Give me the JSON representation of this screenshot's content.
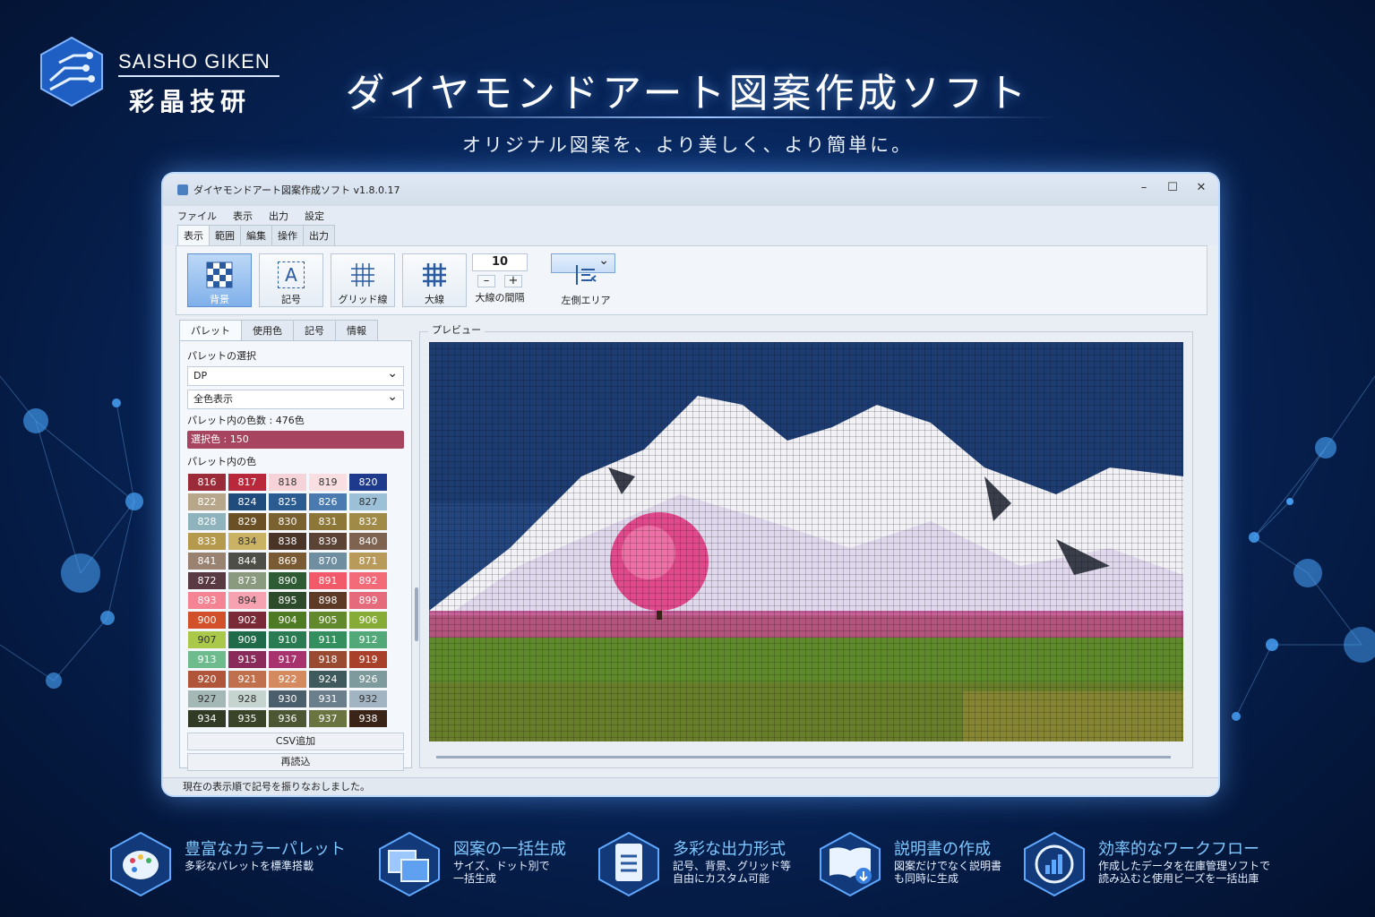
{
  "brand": {
    "en": "SAISHO GIKEN",
    "jp": "彩晶技研"
  },
  "hero": {
    "title": "ダイヤモンドアート図案作成ソフト",
    "subtitle": "オリジナル図案を、より美しく、より簡単に。"
  },
  "window": {
    "title": "ダイヤモンドアート図案作成ソフト v1.8.0.17",
    "controls": [
      "–",
      "☐",
      "✕"
    ],
    "menu": [
      "ファイル",
      "表示",
      "出力",
      "設定"
    ],
    "ribbon_tabs": [
      "表示",
      "範囲",
      "編集",
      "操作",
      "出力"
    ],
    "ribbon": {
      "background": "背景",
      "symbol": "記号",
      "symbol_glyph": "A",
      "grid": "グリッド線",
      "thick": "大線",
      "interval_value": "10",
      "minus": "–",
      "plus": "+",
      "interval_label": "大線の間隔",
      "left_area": "左側エリア"
    },
    "panel_tabs": [
      "パレット",
      "使用色",
      "記号",
      "情報"
    ],
    "palette_select_label": "パレットの選択",
    "palette_value": "DP",
    "filter_value": "全色表示",
    "count_text": "パレット内の色数 : 476色",
    "chosen_text": "選択色 : 150",
    "colors_label": "パレット内の色",
    "swatches": [
      {
        "n": "816",
        "c": "#9b2b38"
      },
      {
        "n": "817",
        "c": "#b8283a"
      },
      {
        "n": "818",
        "c": "#f6d3d8"
      },
      {
        "n": "819",
        "c": "#f9dfe2"
      },
      {
        "n": "820",
        "c": "#1e3a8c"
      },
      {
        "n": "822",
        "c": "#b8a68a"
      },
      {
        "n": "824",
        "c": "#1f4c7d"
      },
      {
        "n": "825",
        "c": "#2a5c92"
      },
      {
        "n": "826",
        "c": "#4a7bb0"
      },
      {
        "n": "827",
        "c": "#9cc0d8"
      },
      {
        "n": "828",
        "c": "#8fb3bd"
      },
      {
        "n": "829",
        "c": "#6a5024"
      },
      {
        "n": "830",
        "c": "#7a6230"
      },
      {
        "n": "831",
        "c": "#8c7638"
      },
      {
        "n": "832",
        "c": "#a08a48"
      },
      {
        "n": "833",
        "c": "#b59a4e"
      },
      {
        "n": "834",
        "c": "#c9b264"
      },
      {
        "n": "838",
        "c": "#4a3428"
      },
      {
        "n": "839",
        "c": "#5a4234"
      },
      {
        "n": "840",
        "c": "#7e6450"
      },
      {
        "n": "841",
        "c": "#9a8270"
      },
      {
        "n": "844",
        "c": "#4e4e48"
      },
      {
        "n": "869",
        "c": "#7a5a32"
      },
      {
        "n": "870",
        "c": "#6f8fa0"
      },
      {
        "n": "871",
        "c": "#b89a5a"
      },
      {
        "n": "872",
        "c": "#5a3a42"
      },
      {
        "n": "873",
        "c": "#8a9a7e"
      },
      {
        "n": "890",
        "c": "#2e5a34"
      },
      {
        "n": "891",
        "c": "#f25a6a"
      },
      {
        "n": "892",
        "c": "#f36a78"
      },
      {
        "n": "893",
        "c": "#f48494"
      },
      {
        "n": "894",
        "c": "#f6a2b0"
      },
      {
        "n": "895",
        "c": "#2d4a2a"
      },
      {
        "n": "898",
        "c": "#5c3a26"
      },
      {
        "n": "899",
        "c": "#e46a7c"
      },
      {
        "n": "900",
        "c": "#d2502a"
      },
      {
        "n": "902",
        "c": "#7a2a36"
      },
      {
        "n": "904",
        "c": "#4f7a24"
      },
      {
        "n": "905",
        "c": "#628a2c"
      },
      {
        "n": "906",
        "c": "#86ab36"
      },
      {
        "n": "907",
        "c": "#aac84a"
      },
      {
        "n": "909",
        "c": "#1f6a48"
      },
      {
        "n": "910",
        "c": "#2a7a52"
      },
      {
        "n": "911",
        "c": "#33905e"
      },
      {
        "n": "912",
        "c": "#52a878"
      },
      {
        "n": "913",
        "c": "#6ebc8e"
      },
      {
        "n": "915",
        "c": "#8a2a5a"
      },
      {
        "n": "917",
        "c": "#a8326e"
      },
      {
        "n": "918",
        "c": "#9a4a30"
      },
      {
        "n": "919",
        "c": "#a8402a"
      },
      {
        "n": "920",
        "c": "#b0543a"
      },
      {
        "n": "921",
        "c": "#c0704c"
      },
      {
        "n": "922",
        "c": "#d48a5e"
      },
      {
        "n": "924",
        "c": "#3f5a5c"
      },
      {
        "n": "926",
        "c": "#7e9a9c"
      },
      {
        "n": "927",
        "c": "#a4b8b6"
      },
      {
        "n": "928",
        "c": "#c6d4d0"
      },
      {
        "n": "930",
        "c": "#4a5e6c"
      },
      {
        "n": "931",
        "c": "#6a7e8c"
      },
      {
        "n": "932",
        "c": "#a2b4c2"
      },
      {
        "n": "934",
        "c": "#313a24"
      },
      {
        "n": "935",
        "c": "#3a4428"
      },
      {
        "n": "936",
        "c": "#4c5632"
      },
      {
        "n": "937",
        "c": "#6a7440"
      },
      {
        "n": "938",
        "c": "#3a2418"
      }
    ],
    "csv_button": "CSV追加",
    "reload_button": "再読込",
    "preview_label": "プレビュー",
    "status": "現在の表示順で記号を振りなおしました。"
  },
  "features": [
    {
      "title": "豊富なカラーパレット",
      "desc": "多彩なパレットを標準搭載"
    },
    {
      "title": "図案の一括生成",
      "desc": "サイズ、ドット別で\n一括生成"
    },
    {
      "title": "多彩な出力形式",
      "desc": "記号、背景、グリッド等\n自由にカスタム可能"
    },
    {
      "title": "説明書の作成",
      "desc": "図案だけでなく説明書\nも同時に生成"
    },
    {
      "title": "効率的なワークフロー",
      "desc": "作成したデータを在庫管理ソフトで\n読み込むと使用ビーズを一括出庫"
    }
  ]
}
